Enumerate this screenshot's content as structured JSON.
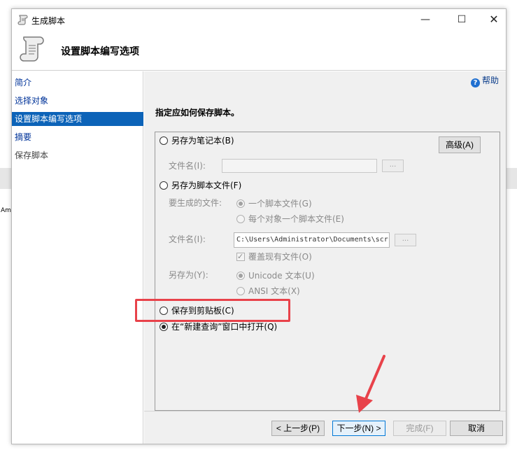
{
  "window": {
    "title": "生成脚本",
    "minimize": "—",
    "maximize": "☐",
    "close": "✕"
  },
  "header": {
    "title": "设置脚本编写选项"
  },
  "sidebar": {
    "items": [
      {
        "label": "简介",
        "state": "normal"
      },
      {
        "label": "选择对象",
        "state": "normal"
      },
      {
        "label": "设置脚本编写选项",
        "state": "selected"
      },
      {
        "label": "摘要",
        "state": "normal"
      },
      {
        "label": "保存脚本",
        "state": "disabled"
      }
    ]
  },
  "help": {
    "label": "帮助",
    "icon": "?"
  },
  "prompt": "指定应如何保存脚本。",
  "options": {
    "notebook": {
      "label": "另存为笔记本(B)"
    },
    "notebook_filename_label": "文件名(I):",
    "notebook_browse": "...",
    "advanced_button": "高级(A)",
    "script_file": {
      "label": "另存为脚本文件(F)"
    },
    "files_to_generate_label": "要生成的文件:",
    "single_file": "一个脚本文件(G)",
    "file_per_object": "每个对象一个脚本文件(E)",
    "script_filename_label": "文件名(I):",
    "script_filename_value": "C:\\Users\\Administrator\\Documents\\scr",
    "script_browse": "...",
    "overwrite": "覆盖现有文件(O)",
    "save_as_label": "另存为(Y):",
    "unicode": "Unicode 文本(U)",
    "ansi": "ANSI 文本(X)",
    "clipboard": "保存到剪贴板(C)",
    "new_query": "在“新建查询”窗口中打开(Q)"
  },
  "footer": {
    "prev": "< 上一步(P)",
    "next": "下一步(N) >",
    "finish": "完成(F)",
    "cancel": "取消"
  },
  "background": {
    "fragment": "Am"
  },
  "colors": {
    "selection": "#0c63b8",
    "annotation": "#e8424a",
    "link": "#003399"
  }
}
